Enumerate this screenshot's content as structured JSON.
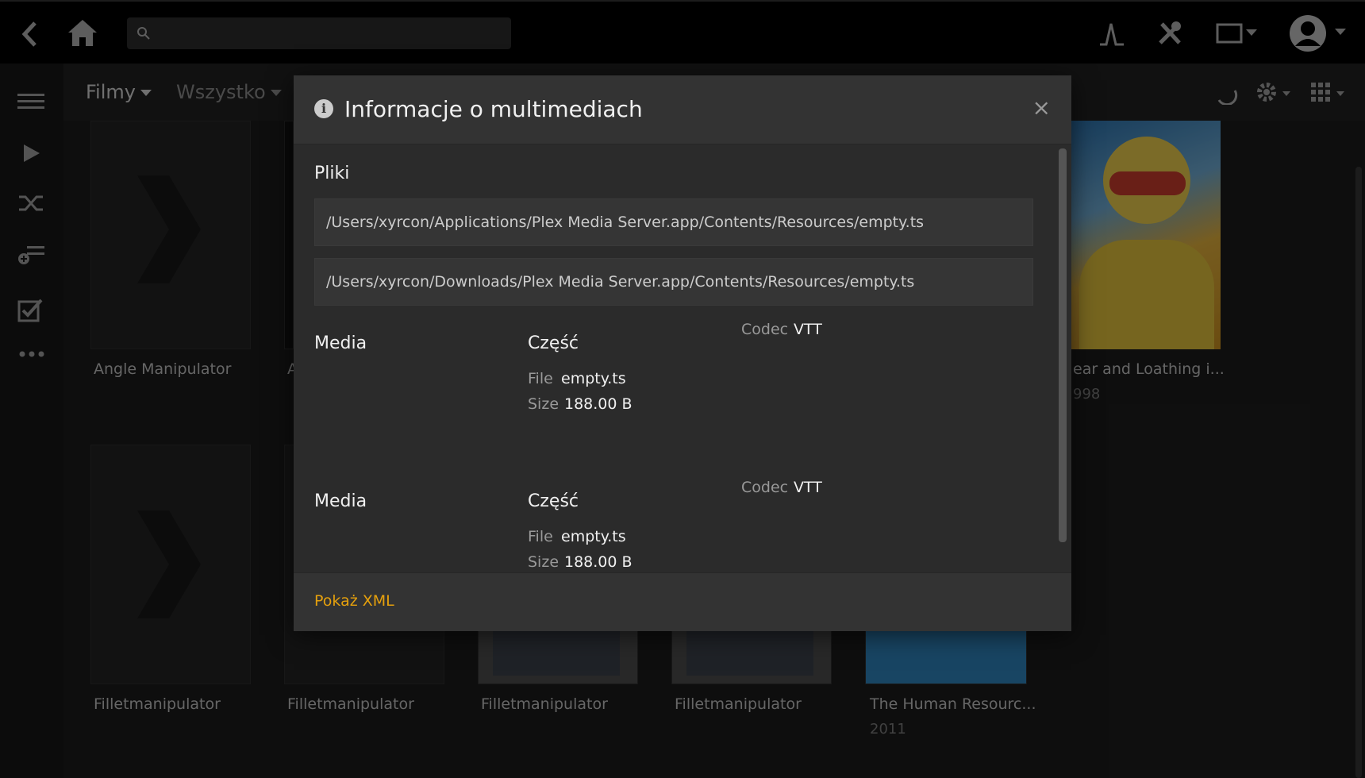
{
  "topbar": {
    "search_placeholder": ""
  },
  "subbar": {
    "library": "Filmy",
    "filter": "Wszystko"
  },
  "cards": [
    {
      "title": "Angle Manipulator",
      "year": ""
    },
    {
      "title": "A",
      "year": ""
    },
    {
      "title": "ear and Loathing i...",
      "year": "998"
    },
    {
      "title": "Filletmanipulator",
      "year": ""
    },
    {
      "title": "Filletmanipulator",
      "year": ""
    },
    {
      "title": "Filletmanipulator",
      "year": ""
    },
    {
      "title": "Filletmanipulator",
      "year": ""
    },
    {
      "title": "The Human Resourc...",
      "year": "2011"
    }
  ],
  "modal": {
    "title": "Informacje o multimediach",
    "files_heading": "Pliki",
    "files": [
      "/Users/xyrcon/Applications/Plex Media Server.app/Contents/Resources/empty.ts",
      "/Users/xyrcon/Downloads/Plex Media Server.app/Contents/Resources/empty.ts"
    ],
    "media": [
      {
        "media_label": "Media",
        "part_label": "Część",
        "codec_label": "Codec",
        "codec": "VTT",
        "file_label": "File",
        "file": "empty.ts",
        "size_label": "Size",
        "size": "188.00 B"
      },
      {
        "media_label": "Media",
        "part_label": "Część",
        "codec_label": "Codec",
        "codec": "VTT",
        "file_label": "File",
        "file": "empty.ts",
        "size_label": "Size",
        "size": "188.00 B"
      }
    ],
    "show_xml": "Pokaż XML",
    "close": "×"
  },
  "colors": {
    "accent": "#e5a00d",
    "background": "#1b1b1b",
    "topbar": "#000000"
  }
}
